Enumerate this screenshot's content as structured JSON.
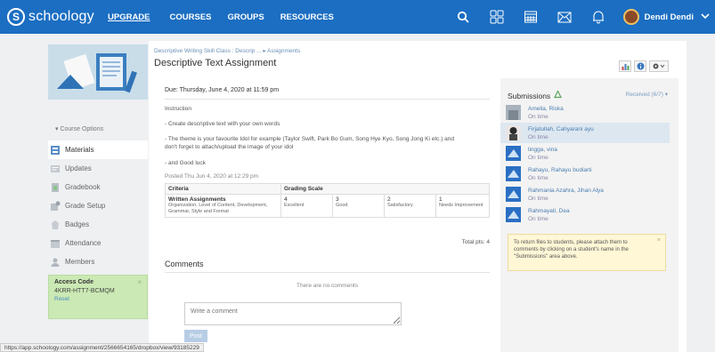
{
  "topbar": {
    "logo_text": "schoology",
    "nav": [
      "UPGRADE",
      "COURSES",
      "GROUPS",
      "RESOURCES"
    ],
    "user_name": "Dendi Dendi"
  },
  "sidebar": {
    "course_options": "▾ Course Options",
    "items": [
      {
        "label": "Materials",
        "icon": "materials-icon"
      },
      {
        "label": "Updates",
        "icon": "updates-icon"
      },
      {
        "label": "Gradebook",
        "icon": "gradebook-icon"
      },
      {
        "label": "Grade Setup",
        "icon": "grade-setup-icon"
      },
      {
        "label": "Badges",
        "icon": "badges-icon"
      },
      {
        "label": "Attendance",
        "icon": "attendance-icon"
      },
      {
        "label": "Members",
        "icon": "members-icon"
      }
    ],
    "access": {
      "title": "Access Code",
      "code": "4KRR-HTT7-BCMQM",
      "reset": "Reset",
      "close": "×"
    }
  },
  "main": {
    "breadcrumb": "Descriptive Writing Skill Class : Descrip ... ▸ Assignments",
    "title": "Descriptive Text Assignment",
    "due": "Due: Thursday, June 4, 2020 at 11:59 pm",
    "instruction": "Instruction",
    "line1": "- Create descriptive text with your own words",
    "line2a": "- The theme is your favourite Idol for example (Taylor Swift, Park Bo Gum, Song Hye Kyo, Song Jong Ki etc.) and",
    "line2b": "don't forget to attach/upload the image of your idol",
    "line3": "- and Good luck",
    "posted": "Posted Thu Jun 4, 2020 at 12:29 pm",
    "rubric": {
      "h_criteria": "Criteria",
      "h_scale": "Grading Scale",
      "crit_name": "Written Assignments",
      "crit_desc": "Organization, Level of Content, Development, Grammar, Style and Format",
      "levels": [
        {
          "score": "4",
          "label": "Excellent"
        },
        {
          "score": "3",
          "label": "Good"
        },
        {
          "score": "2",
          "label": "Satisfactory"
        },
        {
          "score": "1",
          "label": "Needs Improvement"
        }
      ]
    },
    "total": "Total pts: 4",
    "comments_heading": "Comments",
    "no_comments": "There are no comments",
    "comment_placeholder": "Write a comment",
    "post": "Post"
  },
  "submissions": {
    "title": "Submissions",
    "received": "Received (6/7) ▾",
    "items": [
      {
        "name": "Amelia, Riska",
        "status": "On time"
      },
      {
        "name": "Firjatullah, Cahyarani ayu",
        "status": "On time"
      },
      {
        "name": "lingga, vina",
        "status": "On time"
      },
      {
        "name": "Rahayu, Rahayu budiarti",
        "status": "On time"
      },
      {
        "name": "Rahmania Azahra, Jihan Alya",
        "status": "On time"
      },
      {
        "name": "Rahmayati, Dea",
        "status": "On time"
      }
    ],
    "notice": "To return files to students, please attach them to comments by clicking on a student's name in the \"Submissions\" area above.",
    "notice_close": "×"
  },
  "status_url": "https://app.schoology.com/assignment/2566654165/dropbox/view/93185229",
  "colors": {
    "brand": "#1b6ec2",
    "access_bg": "#cbe9b4",
    "notice_bg": "#fff7d6"
  }
}
